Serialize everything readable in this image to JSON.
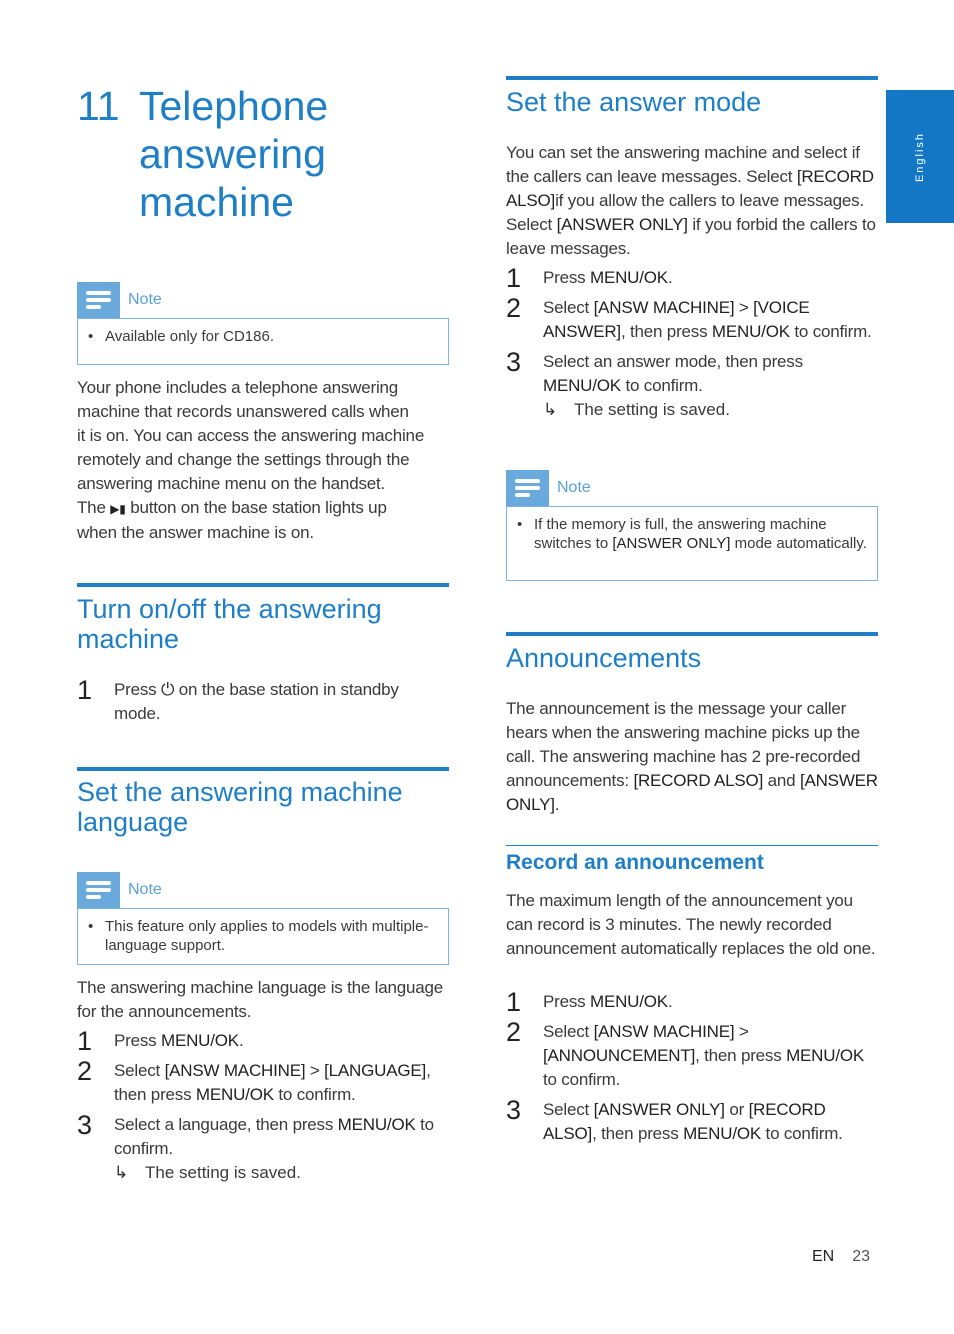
{
  "chapter": {
    "number": "11",
    "title_lines": [
      "Telephone",
      "answering",
      "machine"
    ]
  },
  "side_tab": {
    "label": "English"
  },
  "note_label": "Note",
  "note1": {
    "text": "Available only for CD186."
  },
  "intro": {
    "lines": [
      "Your phone includes a telephone answering",
      "machine that records unanswered calls when",
      "it is on. You can access the answering machine",
      "remotely and change the settings through the",
      "answering machine menu on the handset."
    ],
    "line6_pre": "The",
    "play_icon": "▶▮",
    "line6_post": "button on the base station lights up",
    "line7": "when the answer machine is on."
  },
  "turn_on_off": {
    "title_lines": [
      "Turn on/off the answering",
      "machine"
    ],
    "step1_pre": "Press",
    "power_icon": "⏻",
    "step1_post": "on the base station in standby mode."
  },
  "language": {
    "title_lines": [
      "Set the answering machine",
      "language"
    ],
    "note_text": "This feature only applies to models with multiple-language support.",
    "intro": "The answering machine language is the language for the announcements.",
    "steps": {
      "s1_pre": "Press",
      "s1_b": "MENU/OK",
      "s1_post": ".",
      "s2_pre": "Select",
      "s2_b1": "[ANSW MACHINE]",
      "s2_mid": " > ",
      "s2_b2": "[LANGUAGE]",
      "s2_mid2": ", then press",
      "s2_b3": "MENU/OK",
      "s2_post": "to confirm.",
      "s3_pre": "Select a language, then press",
      "s3_b": "MENU/OK",
      "s3_post": "to confirm.",
      "result": "The setting is saved."
    }
  },
  "answer_mode": {
    "title": "Set the answer mode",
    "intro_a": "You can set the answering machine and select if the callers can leave messages. Select",
    "intro_b1": "[RECORD ALSO]",
    "intro_c": "if you allow the callers to leave messages. Select",
    "intro_b2": "[ANSWER ONLY]",
    "intro_d": "if you forbid the callers to leave messages.",
    "steps": {
      "s1_pre": "Press",
      "s1_b": "MENU/OK",
      "s1_post": ".",
      "s2_pre": "Select",
      "s2_b1": "[ANSW MACHINE]",
      "s2_mid": " > ",
      "s2_b2": "[VOICE ANSWER]",
      "s2_mid2": ", then press",
      "s2_b3": "MENU/OK",
      "s2_post": "to confirm.",
      "s3_pre": "Select an answer mode, then press",
      "s3_b": "MENU/OK",
      "s3_post": "to confirm.",
      "result": "The setting is saved."
    },
    "note_pre": "If the memory is full, the answering machine switches to",
    "note_b": "[ANSWER ONLY]",
    "note_post": "mode automatically."
  },
  "announcements": {
    "title": "Announcements",
    "intro_a": "The announcement is the message your caller hears when the answering machine picks up the call. The answering machine has 2 pre-recorded announcements:",
    "intro_b1": "[RECORD ALSO]",
    "intro_c": "and",
    "intro_b2": "[ANSWER ONLY]",
    "intro_d": ".",
    "record": {
      "title": "Record an announcement",
      "intro": "The maximum length of the announcement you can record is 3 minutes. The newly recorded announcement automatically replaces the old one.",
      "steps": {
        "s1_pre": "Press",
        "s1_b": "MENU/OK",
        "s1_post": ".",
        "s2_pre": "Select",
        "s2_b1": "[ANSW MACHINE]",
        "s2_mid": " > ",
        "s2_b2": "[ANNOUNCEMENT]",
        "s2_mid2": ", then press",
        "s2_b3": "MENU/OK",
        "s2_post": "to confirm.",
        "s3_pre": "Select",
        "s3_b1": "[ANSWER ONLY]",
        "s3_mid": "or",
        "s3_b2": "[RECORD ALSO]",
        "s3_mid2": ", then press",
        "s3_b3": "MENU/OK",
        "s3_post": "to confirm."
      }
    }
  },
  "footer": {
    "lang": "EN",
    "page": "23"
  },
  "step_numbers": [
    "1",
    "2",
    "3"
  ],
  "result_arrow": "↳",
  "bullet": "•"
}
